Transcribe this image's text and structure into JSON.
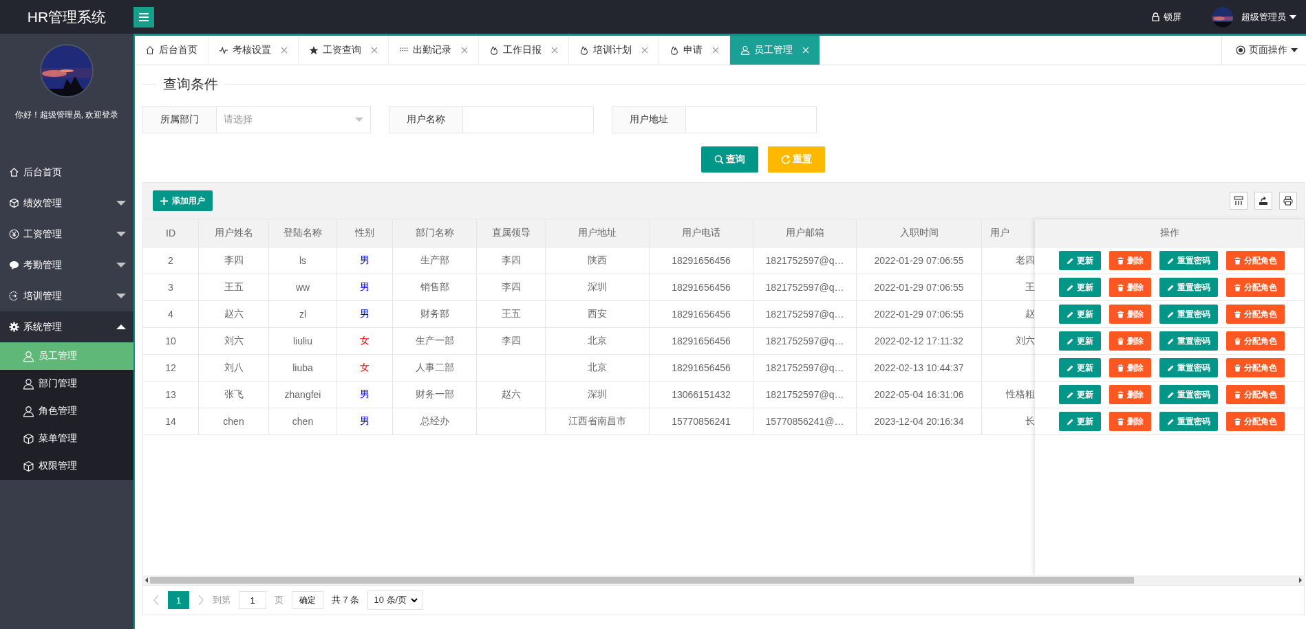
{
  "header": {
    "logo": "HR管理系统",
    "lock": "锁屏",
    "user": "超级管理员"
  },
  "sidebar": {
    "greeting": "你好！超级管理员, 欢迎登录",
    "items": [
      {
        "label": "后台首页",
        "kind": "home"
      },
      {
        "label": "绩效管理",
        "kind": "cube",
        "expanded": false
      },
      {
        "label": "工资管理",
        "kind": "yen",
        "expanded": false
      },
      {
        "label": "考勤管理",
        "kind": "chat",
        "expanded": false
      },
      {
        "label": "培训管理",
        "kind": "cycle",
        "expanded": false
      },
      {
        "label": "系统管理",
        "kind": "gear",
        "expanded": true,
        "children": [
          {
            "label": "员工管理",
            "kind": "user",
            "selected": true
          },
          {
            "label": "部门管理",
            "kind": "user",
            "selected": false
          },
          {
            "label": "角色管理",
            "kind": "user",
            "selected": false
          },
          {
            "label": "菜单管理",
            "kind": "cube",
            "selected": false
          },
          {
            "label": "权限管理",
            "kind": "cube",
            "selected": false
          }
        ]
      }
    ]
  },
  "tabs": [
    {
      "label": "后台首页",
      "kind": "home",
      "selected": false,
      "closable": false
    },
    {
      "label": "考核设置",
      "kind": "pulse",
      "selected": false,
      "closable": true
    },
    {
      "label": "工资查询",
      "kind": "star",
      "selected": false,
      "closable": true
    },
    {
      "label": "出勤记录",
      "kind": "dots",
      "selected": false,
      "closable": true
    },
    {
      "label": "工作日报",
      "kind": "fire",
      "selected": false,
      "closable": true
    },
    {
      "label": "培训计划",
      "kind": "fire",
      "selected": false,
      "closable": true
    },
    {
      "label": "申请",
      "kind": "fire",
      "selected": false,
      "closable": true
    },
    {
      "label": "员工管理",
      "kind": "user",
      "selected": true,
      "closable": true
    }
  ],
  "page_actions": "页面操作",
  "query": {
    "legend": "查询条件",
    "fields": [
      {
        "label": "所属部门",
        "placeholder": "请选择",
        "kind": "select"
      },
      {
        "label": "用户名称",
        "kind": "text"
      },
      {
        "label": "用户地址",
        "kind": "text"
      }
    ],
    "buttons": [
      {
        "label": "查询",
        "kind": "search"
      },
      {
        "label": "重置",
        "kind": "reset"
      }
    ]
  },
  "toolbar": {
    "add_button": "添加用户"
  },
  "table": {
    "columns": [
      "ID",
      "用户姓名",
      "登陆名称",
      "性别",
      "部门名称",
      "直属领导",
      "用户地址",
      "用户电话",
      "用户邮箱",
      "入职时间",
      "用户"
    ],
    "action_column": "操作",
    "rows": [
      {
        "cells": [
          "2",
          "李四",
          "ls",
          "男",
          "生产部",
          "李四",
          "陕西",
          "18291656456",
          "1821752597@q…",
          "2022-01-29 07:06:55",
          "老四"
        ],
        "color": "#0000ff",
        "actions": [
          {
            "label": "更新",
            "kind": "edit"
          },
          {
            "label": "删除",
            "kind": "delete"
          },
          {
            "label": "重置密码",
            "kind": "edit"
          },
          {
            "label": "分配角色",
            "kind": "delete"
          }
        ]
      },
      {
        "cells": [
          "3",
          "王五",
          "ww",
          "男",
          "销售部",
          "李四",
          "深圳",
          "18291656456",
          "1821752597@q…",
          "2022-01-29 07:06:55",
          "王"
        ],
        "color": "#0000ff",
        "actions": [
          {
            "label": "更新",
            "kind": "edit"
          },
          {
            "label": "删除",
            "kind": "delete"
          },
          {
            "label": "重置密码",
            "kind": "edit"
          },
          {
            "label": "分配角色",
            "kind": "delete"
          }
        ]
      },
      {
        "cells": [
          "4",
          "赵六",
          "zl",
          "男",
          "财务部",
          "王五",
          "西安",
          "18291656456",
          "1821752597@q…",
          "2022-01-29 07:06:55",
          "赵"
        ],
        "color": "#0000ff",
        "actions": [
          {
            "label": "更新",
            "kind": "edit"
          },
          {
            "label": "删除",
            "kind": "delete"
          },
          {
            "label": "重置密码",
            "kind": "edit"
          },
          {
            "label": "分配角色",
            "kind": "delete"
          }
        ]
      },
      {
        "cells": [
          "10",
          "刘六",
          "liuliu",
          "女",
          "生产一部",
          "李四",
          "北京",
          "18291656456",
          "1821752597@q…",
          "2022-02-12 17:11:32",
          "刘六"
        ],
        "color": "#ff0000",
        "actions": [
          {
            "label": "更新",
            "kind": "edit"
          },
          {
            "label": "删除",
            "kind": "delete"
          },
          {
            "label": "重置密码",
            "kind": "edit"
          },
          {
            "label": "分配角色",
            "kind": "delete"
          }
        ]
      },
      {
        "cells": [
          "12",
          "刘八",
          "liuba",
          "女",
          "人事二部",
          "",
          "北京",
          "18291656456",
          "1821752597@q…",
          "2022-02-13 10:44:37",
          ""
        ],
        "color": "#ff0000",
        "actions": [
          {
            "label": "更新",
            "kind": "edit"
          },
          {
            "label": "删除",
            "kind": "delete"
          },
          {
            "label": "重置密码",
            "kind": "edit"
          },
          {
            "label": "分配角色",
            "kind": "delete"
          }
        ]
      },
      {
        "cells": [
          "13",
          "张飞",
          "zhangfei",
          "男",
          "财务一部",
          "赵六",
          "深圳",
          "13066151432",
          "1821752597@q…",
          "2022-05-04 16:31:06",
          "性格粗"
        ],
        "color": "#0000ff",
        "actions": [
          {
            "label": "更新",
            "kind": "edit"
          },
          {
            "label": "删除",
            "kind": "delete"
          },
          {
            "label": "重置密码",
            "kind": "edit"
          },
          {
            "label": "分配角色",
            "kind": "delete"
          }
        ]
      },
      {
        "cells": [
          "14",
          "chen",
          "chen",
          "男",
          "总经办",
          "",
          "江西省南昌市",
          "15770856241",
          "15770856241@…",
          "2023-12-04 20:16:34",
          "长"
        ],
        "color": "#0000ff",
        "actions": [
          {
            "label": "更新",
            "kind": "edit"
          },
          {
            "label": "删除",
            "kind": "delete"
          },
          {
            "label": "重置密码",
            "kind": "edit"
          },
          {
            "label": "分配角色",
            "kind": "delete"
          }
        ]
      }
    ]
  },
  "pagination": {
    "pages": [
      {
        "label": "1",
        "selected": true
      }
    ],
    "goto": "到第",
    "page_input": "1",
    "page_unit": "页",
    "confirm": "确定",
    "total": "共 7 条",
    "page_size": "10 条/页"
  }
}
